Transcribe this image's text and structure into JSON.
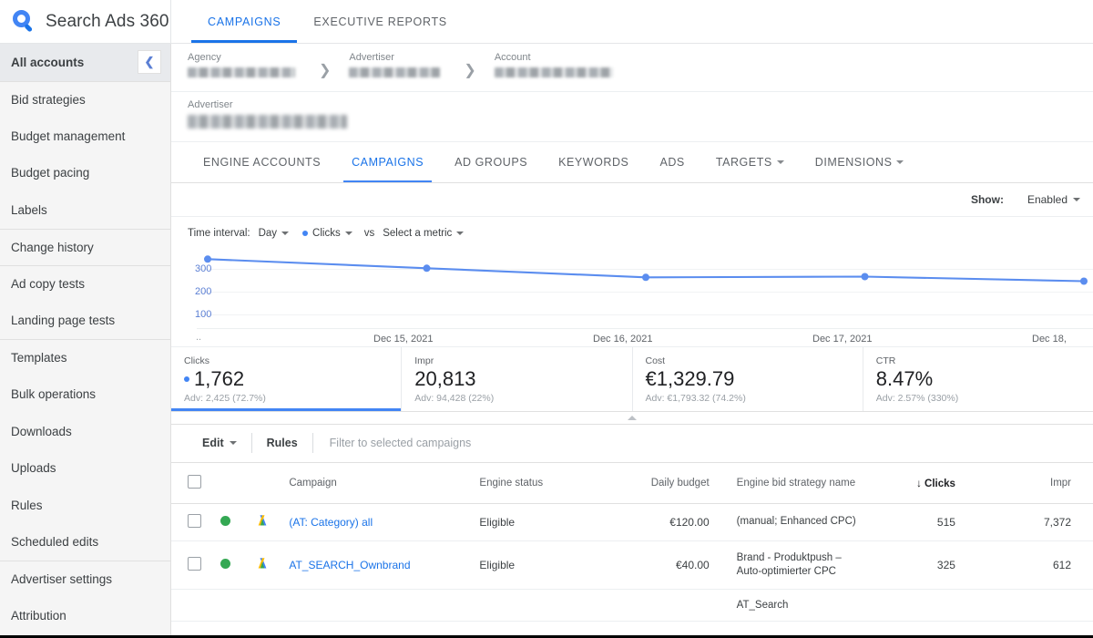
{
  "brand": {
    "title": "Search Ads 360",
    "logo_icon": "search-loupe-icon"
  },
  "top_tabs": [
    {
      "label": "CAMPAIGNS",
      "active": true
    },
    {
      "label": "EXECUTIVE REPORTS",
      "active": false
    }
  ],
  "sidebar": {
    "items": [
      {
        "label": "All accounts",
        "selected": true,
        "divider_above": false
      },
      {
        "label": "Bid strategies",
        "selected": false,
        "divider_above": true
      },
      {
        "label": "Budget management",
        "selected": false,
        "divider_above": false
      },
      {
        "label": "Budget pacing",
        "selected": false,
        "divider_above": false
      },
      {
        "label": "Labels",
        "selected": false,
        "divider_above": false
      },
      {
        "label": "Change history",
        "selected": false,
        "divider_above": true
      },
      {
        "label": "Ad copy tests",
        "selected": false,
        "divider_above": true
      },
      {
        "label": "Landing page tests",
        "selected": false,
        "divider_above": false
      },
      {
        "label": "Templates",
        "selected": false,
        "divider_above": true
      },
      {
        "label": "Bulk operations",
        "selected": false,
        "divider_above": false
      },
      {
        "label": "Downloads",
        "selected": false,
        "divider_above": false
      },
      {
        "label": "Uploads",
        "selected": false,
        "divider_above": false
      },
      {
        "label": "Rules",
        "selected": false,
        "divider_above": false
      },
      {
        "label": "Scheduled edits",
        "selected": false,
        "divider_above": false
      },
      {
        "label": "Advertiser settings",
        "selected": false,
        "divider_above": true
      },
      {
        "label": "Attribution",
        "selected": false,
        "divider_above": false
      }
    ],
    "collapse_icon": "chevron-left-icon"
  },
  "breadcrumbs": [
    {
      "label": "Agency",
      "value": "",
      "redacted": true
    },
    {
      "label": "Advertiser",
      "value": "",
      "redacted": true
    },
    {
      "label": "Account",
      "value": "",
      "redacted": true
    }
  ],
  "advertiser_band": {
    "label": "Advertiser",
    "value": "",
    "redacted": true
  },
  "sub_tabs": [
    {
      "label": "ENGINE ACCOUNTS",
      "active": false,
      "caret": false
    },
    {
      "label": "CAMPAIGNS",
      "active": true,
      "caret": false
    },
    {
      "label": "AD GROUPS",
      "active": false,
      "caret": false
    },
    {
      "label": "KEYWORDS",
      "active": false,
      "caret": false
    },
    {
      "label": "ADS",
      "active": false,
      "caret": false
    },
    {
      "label": "TARGETS",
      "active": false,
      "caret": true
    },
    {
      "label": "DIMENSIONS",
      "active": false,
      "caret": true
    }
  ],
  "show_filter": {
    "label": "Show:",
    "value": "Enabled"
  },
  "chart_controls": {
    "time_interval_label": "Time interval:",
    "interval_value": "Day",
    "metric_primary": "Clicks",
    "vs_label": "vs",
    "metric_secondary": "Select a metric"
  },
  "chart_data": {
    "type": "line",
    "title": "",
    "xlabel": "",
    "ylabel": "Clicks",
    "x": [
      "",
      "Dec 15, 2021",
      "Dec 16, 2021",
      "Dec 17, 2021",
      "Dec 18,"
    ],
    "tick_labels": [
      "Dec 15, 2021",
      "Dec 16, 2021",
      "Dec 17, 2021",
      "Dec 18,"
    ],
    "series": [
      {
        "name": "Clicks",
        "color": "#5b8def",
        "values": [
          345,
          305,
          265,
          268,
          248
        ]
      }
    ],
    "yticks": [
      100,
      200,
      300
    ],
    "ylim": [
      0,
      350
    ],
    "grid": true,
    "legend": "none"
  },
  "scorecards": [
    {
      "label": "Clicks",
      "value": "1,762",
      "sub": "Adv: 2,425 (72.7%)",
      "active": true,
      "dot": true
    },
    {
      "label": "Impr",
      "value": "20,813",
      "sub": "Adv: 94,428 (22%)",
      "active": false,
      "dot": false
    },
    {
      "label": "Cost",
      "value": "€1,329.79",
      "sub": "Adv: €1,793.32 (74.2%)",
      "active": false,
      "dot": false
    },
    {
      "label": "CTR",
      "value": "8.47%",
      "sub": "Adv: 2.57% (330%)",
      "active": false,
      "dot": false
    }
  ],
  "toolbar": {
    "edit_label": "Edit",
    "rules_label": "Rules",
    "filter_placeholder": "Filter to selected campaigns"
  },
  "table": {
    "columns": [
      "Campaign",
      "Engine status",
      "Daily budget",
      "Engine bid strategy name",
      "Clicks",
      "Impr"
    ],
    "sorted_column": "Clicks",
    "sort_icon": "arrow-down-icon",
    "rows": [
      {
        "campaign": "(AT: Category) all",
        "engine_status": "Eligible",
        "daily_budget": "€120.00",
        "bid_strategy": "(manual; Enhanced CPC)",
        "clicks": "515",
        "impr": "7,372",
        "status_dot": "green"
      },
      {
        "campaign": "AT_SEARCH_Ownbrand",
        "engine_status": "Eligible",
        "daily_budget": "€40.00",
        "bid_strategy": "Brand - Produktpush – Auto-optimierter CPC",
        "clicks": "325",
        "impr": "612",
        "status_dot": "green"
      }
    ],
    "partial_row": {
      "bid_strategy": "AT_Search"
    }
  },
  "colors": {
    "accent_blue": "#1a73e8",
    "chart_blue": "#5b8def",
    "status_green": "#34a853",
    "sidebar_bg": "#f5f5f5"
  }
}
